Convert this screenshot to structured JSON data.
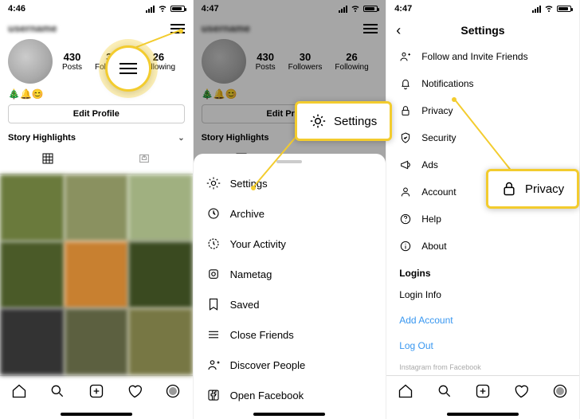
{
  "screen1": {
    "time": "4:46",
    "username": "username",
    "stats": {
      "posts": {
        "n": "430",
        "label": "Posts"
      },
      "followers": {
        "n": "30",
        "label": "Followers"
      },
      "following": {
        "n": "26",
        "label": "Following"
      }
    },
    "emojis": "🎄🔔😊",
    "edit_profile": "Edit Profile",
    "story_highlights": "Story Highlights"
  },
  "screen2": {
    "time": "4:47",
    "username": "username",
    "stats": {
      "posts": {
        "n": "430",
        "label": "Posts"
      },
      "followers": {
        "n": "30",
        "label": "Followers"
      },
      "following": {
        "n": "26",
        "label": "Following"
      }
    },
    "emojis": "🎄🔔😊",
    "edit_profile": "Edit Profile",
    "story_highlights": "Story Highlights",
    "menu": {
      "settings": "Settings",
      "archive": "Archive",
      "your_activity": "Your Activity",
      "nametag": "Nametag",
      "saved": "Saved",
      "close_friends": "Close Friends",
      "discover_people": "Discover People",
      "open_facebook": "Open Facebook"
    }
  },
  "screen3": {
    "time": "4:47",
    "title": "Settings",
    "items": {
      "follow_invite": "Follow and Invite Friends",
      "notifications": "Notifications",
      "privacy": "Privacy",
      "security": "Security",
      "ads": "Ads",
      "account": "Account",
      "help": "Help",
      "about": "About"
    },
    "logins_section": "Logins",
    "login_info": "Login Info",
    "add_account": "Add Account",
    "log_out": "Log Out",
    "footer": "Instagram from Facebook"
  },
  "callouts": {
    "settings": "Settings",
    "privacy": "Privacy"
  }
}
